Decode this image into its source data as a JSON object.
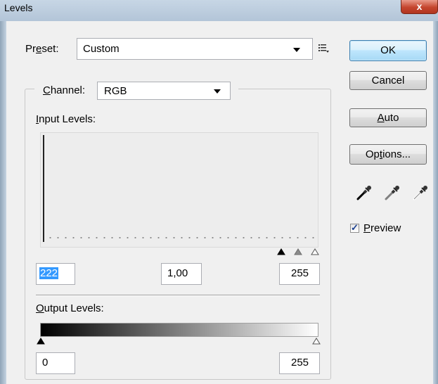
{
  "window": {
    "title": "Levels",
    "close_symbol": "x"
  },
  "preset": {
    "label_before": "Pr",
    "label_access": "e",
    "label_after": "set:",
    "value": "Custom"
  },
  "channel": {
    "label_access": "C",
    "label_after": "hannel:",
    "value": "RGB"
  },
  "input_levels": {
    "label_access": "I",
    "label_after": "nput Levels:",
    "black": "222",
    "gamma": "1,00",
    "white": "255"
  },
  "output_levels": {
    "label_access": "O",
    "label_after": "utput Levels:",
    "black": "0",
    "white": "255"
  },
  "buttons": {
    "ok": "OK",
    "cancel": "Cancel",
    "auto_access": "A",
    "auto_after": "uto",
    "options_before": "Op",
    "options_access": "t",
    "options_after": "ions..."
  },
  "preview": {
    "access": "P",
    "after": "review",
    "checked": true,
    "check_mark": "✓"
  },
  "eyedroppers": [
    "black-point-eyedropper-icon",
    "gray-point-eyedropper-icon",
    "white-point-eyedropper-icon"
  ]
}
